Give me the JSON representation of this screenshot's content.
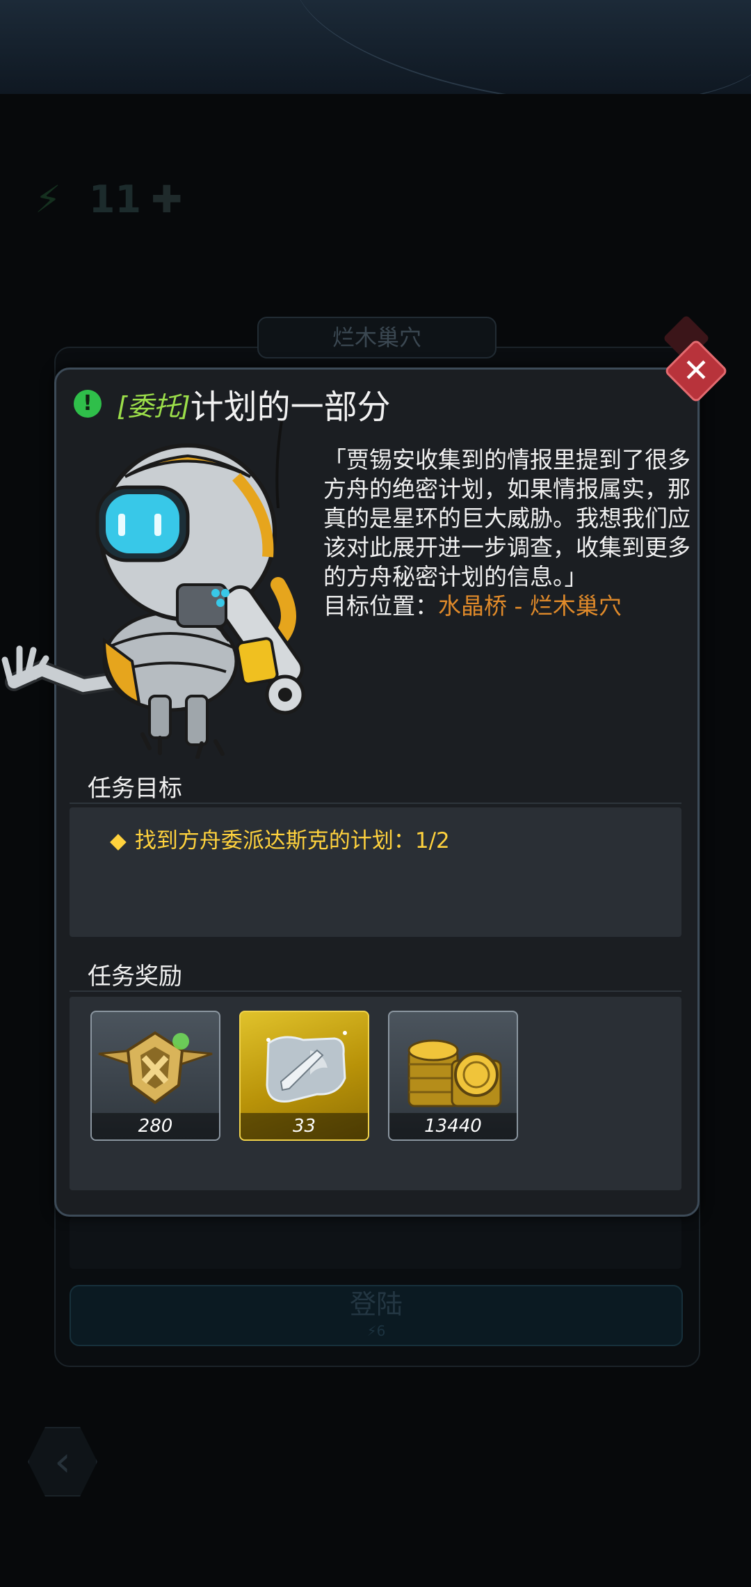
{
  "background": {
    "energy_count": "11",
    "location_tab": "烂木巢穴",
    "launch_button": "登陆",
    "launch_cost": "6"
  },
  "dialog": {
    "tag": "[委托]",
    "title": "计划的一部分",
    "description": "「贾锡安收集到的情报里提到了很多方舟的绝密计划，如果情报属实，那真的是星环的巨大威胁。我想我们应该对此展开进一步调查，收集到更多的方舟秘密计划的信息。」",
    "location_label": "目标位置：",
    "location_value": "水晶桥 - 烂木巢穴",
    "objectives_label": "任务目标",
    "objective": "找到方舟委派达斯克的计划：1/2",
    "rewards_label": "任务奖励",
    "rewards": [
      {
        "icon": "xp-badge-icon",
        "qty": "280"
      },
      {
        "icon": "weapon-part-icon",
        "qty": "33"
      },
      {
        "icon": "gold-coins-icon",
        "qty": "13440"
      }
    ]
  },
  "colors": {
    "accent_green": "#9cdf4a",
    "objective_yellow": "#ffd23d",
    "location_orange": "#e08a2a",
    "close_red": "#b8333b"
  }
}
